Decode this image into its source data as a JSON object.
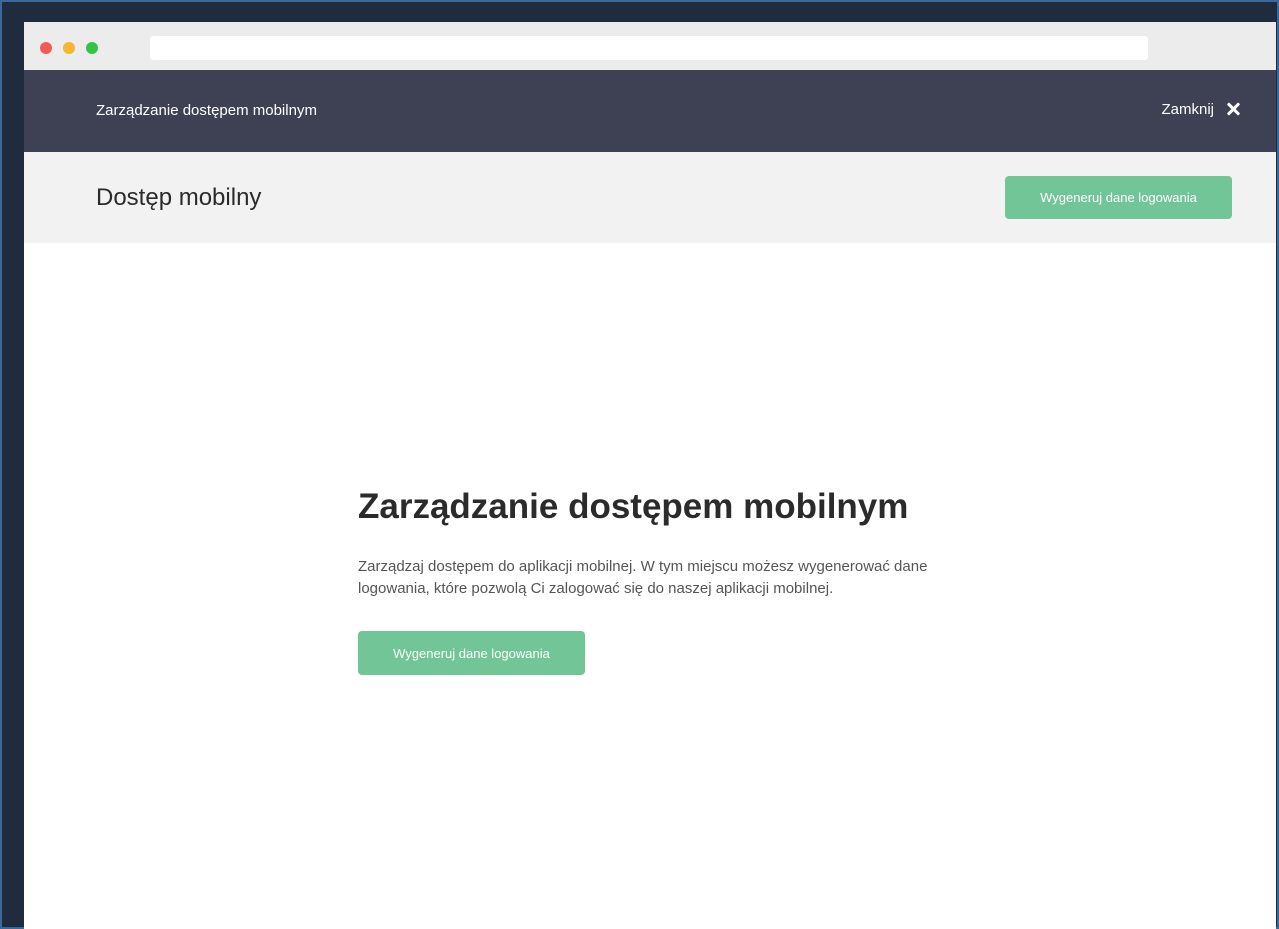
{
  "topbar": {
    "title": "Zarządzanie dostępem mobilnym",
    "close_label": "Zamknij"
  },
  "subheader": {
    "title": "Dostęp mobilny",
    "button_label": "Wygeneruj dane logowania"
  },
  "content": {
    "heading": "Zarządzanie dostępem mobilnym",
    "description": "Zarządzaj dostępem do aplikacji mobilnej. W tym miejscu możesz wygenerować dane logowania, które pozwolą Ci zalogować się do naszej aplikacji mobilnej.",
    "button_label": "Wygeneruj dane logowania"
  },
  "icons": {
    "close": "close-icon"
  },
  "colors": {
    "topbar_bg": "#3d4153",
    "accent_green": "#71c596",
    "subheader_bg": "#f2f2f2"
  }
}
